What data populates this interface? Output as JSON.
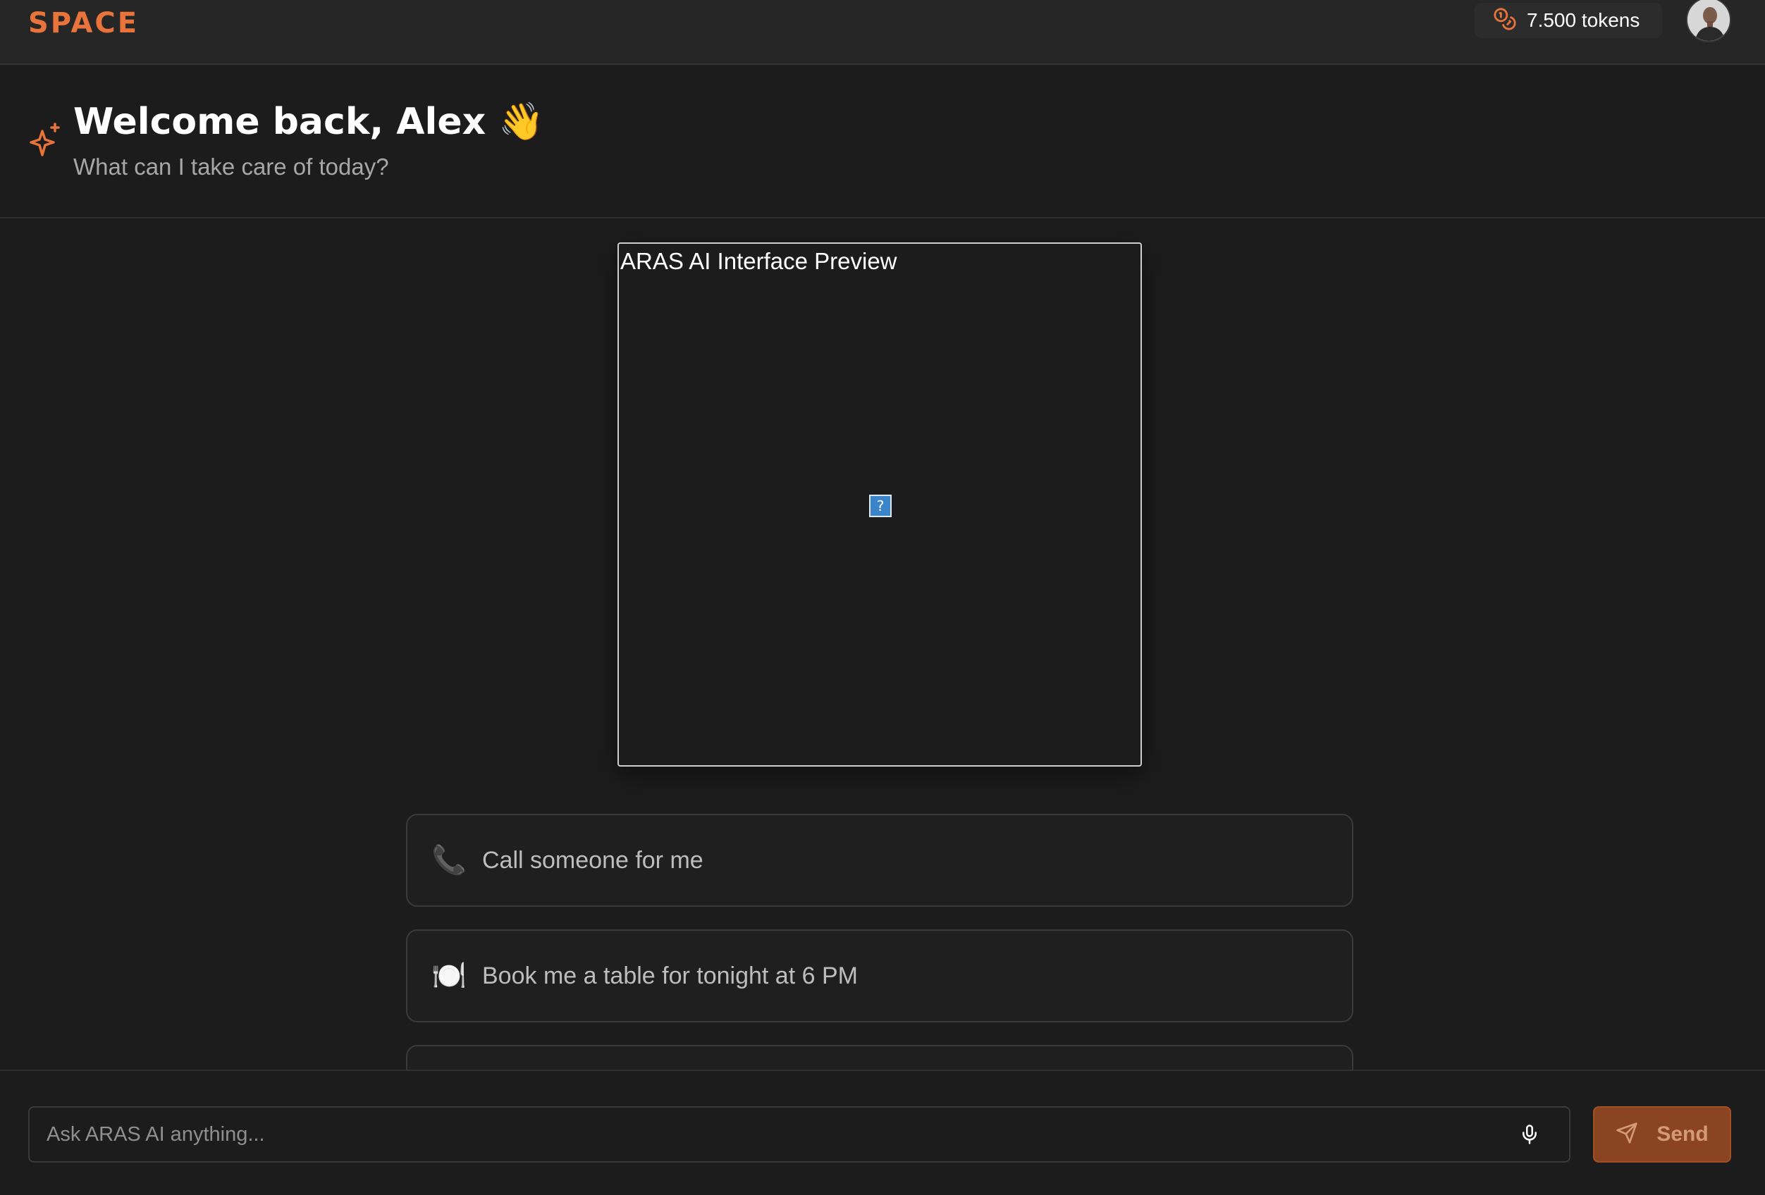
{
  "app": {
    "logo": "SPACE",
    "accent_color": "#e8743b"
  },
  "header": {
    "tokens_label": "7.500 tokens",
    "tokens_icon": "coins-icon",
    "avatar_icon": "user-avatar"
  },
  "welcome": {
    "title": "Welcome back, Alex 👋",
    "subtitle": "What can I take care of today?",
    "icon": "sparkle-icon"
  },
  "preview": {
    "alt_text": "ARAS AI Interface Preview",
    "broken_image_glyph": "?"
  },
  "suggestions": [
    {
      "emoji": "📞",
      "label": "Call someone for me"
    },
    {
      "emoji": "🍽️",
      "label": "Book me a table for tonight at 6 PM"
    },
    {
      "emoji": "",
      "label": ""
    }
  ],
  "composer": {
    "placeholder": "Ask ARAS AI anything...",
    "mic_icon": "microphone-icon",
    "send_label": "Send",
    "send_icon": "send-icon"
  }
}
